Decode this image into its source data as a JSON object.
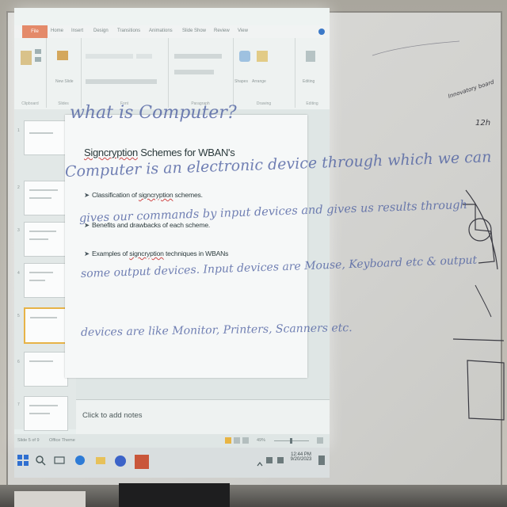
{
  "ribbon": {
    "file_tab": "File",
    "tabs": [
      "Home",
      "Insert",
      "Design",
      "Transitions",
      "Animations",
      "Slide Show",
      "Review",
      "View"
    ],
    "groups": [
      "Clipboard",
      "Slides",
      "Font",
      "Paragraph",
      "Drawing",
      "Editing"
    ],
    "buttons": {
      "new_slide": "New Slide",
      "images": "Shapes",
      "arrange": "Arrange",
      "editing": "Editing"
    }
  },
  "thumbnails": [
    "1",
    "2",
    "3",
    "4",
    "5",
    "6",
    "7"
  ],
  "slide": {
    "title_pre": "Signcryption",
    "title_post": " Schemes for WBAN's",
    "bullets": [
      {
        "pre": "Classification of ",
        "sq": "signcryption",
        "post": " schemes."
      },
      {
        "pre": "Benefits and drawbacks of each scheme.",
        "sq": "",
        "post": ""
      },
      {
        "pre": "Examples of ",
        "sq": "signcryption",
        "post": " techniques in WBANs"
      }
    ]
  },
  "notes_placeholder": "Click to add notes",
  "status": {
    "slide_counter": "Slide 5 of 9",
    "theme": "Office Theme",
    "zoom": "49%"
  },
  "taskbar": {
    "time": "12:44 PM",
    "date": "9/20/2023"
  },
  "whiteboard_handwriting": {
    "line1": "what is Computer?",
    "line2": "Computer is an electronic device through which we can",
    "line3": "gives our commands by input devices and gives us results through",
    "line4": "some output devices. Input devices are Mouse, Keyboard etc & output",
    "line5": "devices are like Monitor, Printers, Scanners etc.",
    "side_note_1": "Innovatory board",
    "side_note_2": "12h"
  },
  "colors": {
    "selected_thumb_border": "#e7b347",
    "file_tab": "#e48a6a",
    "chalk_ink": "#4b5ea0"
  }
}
